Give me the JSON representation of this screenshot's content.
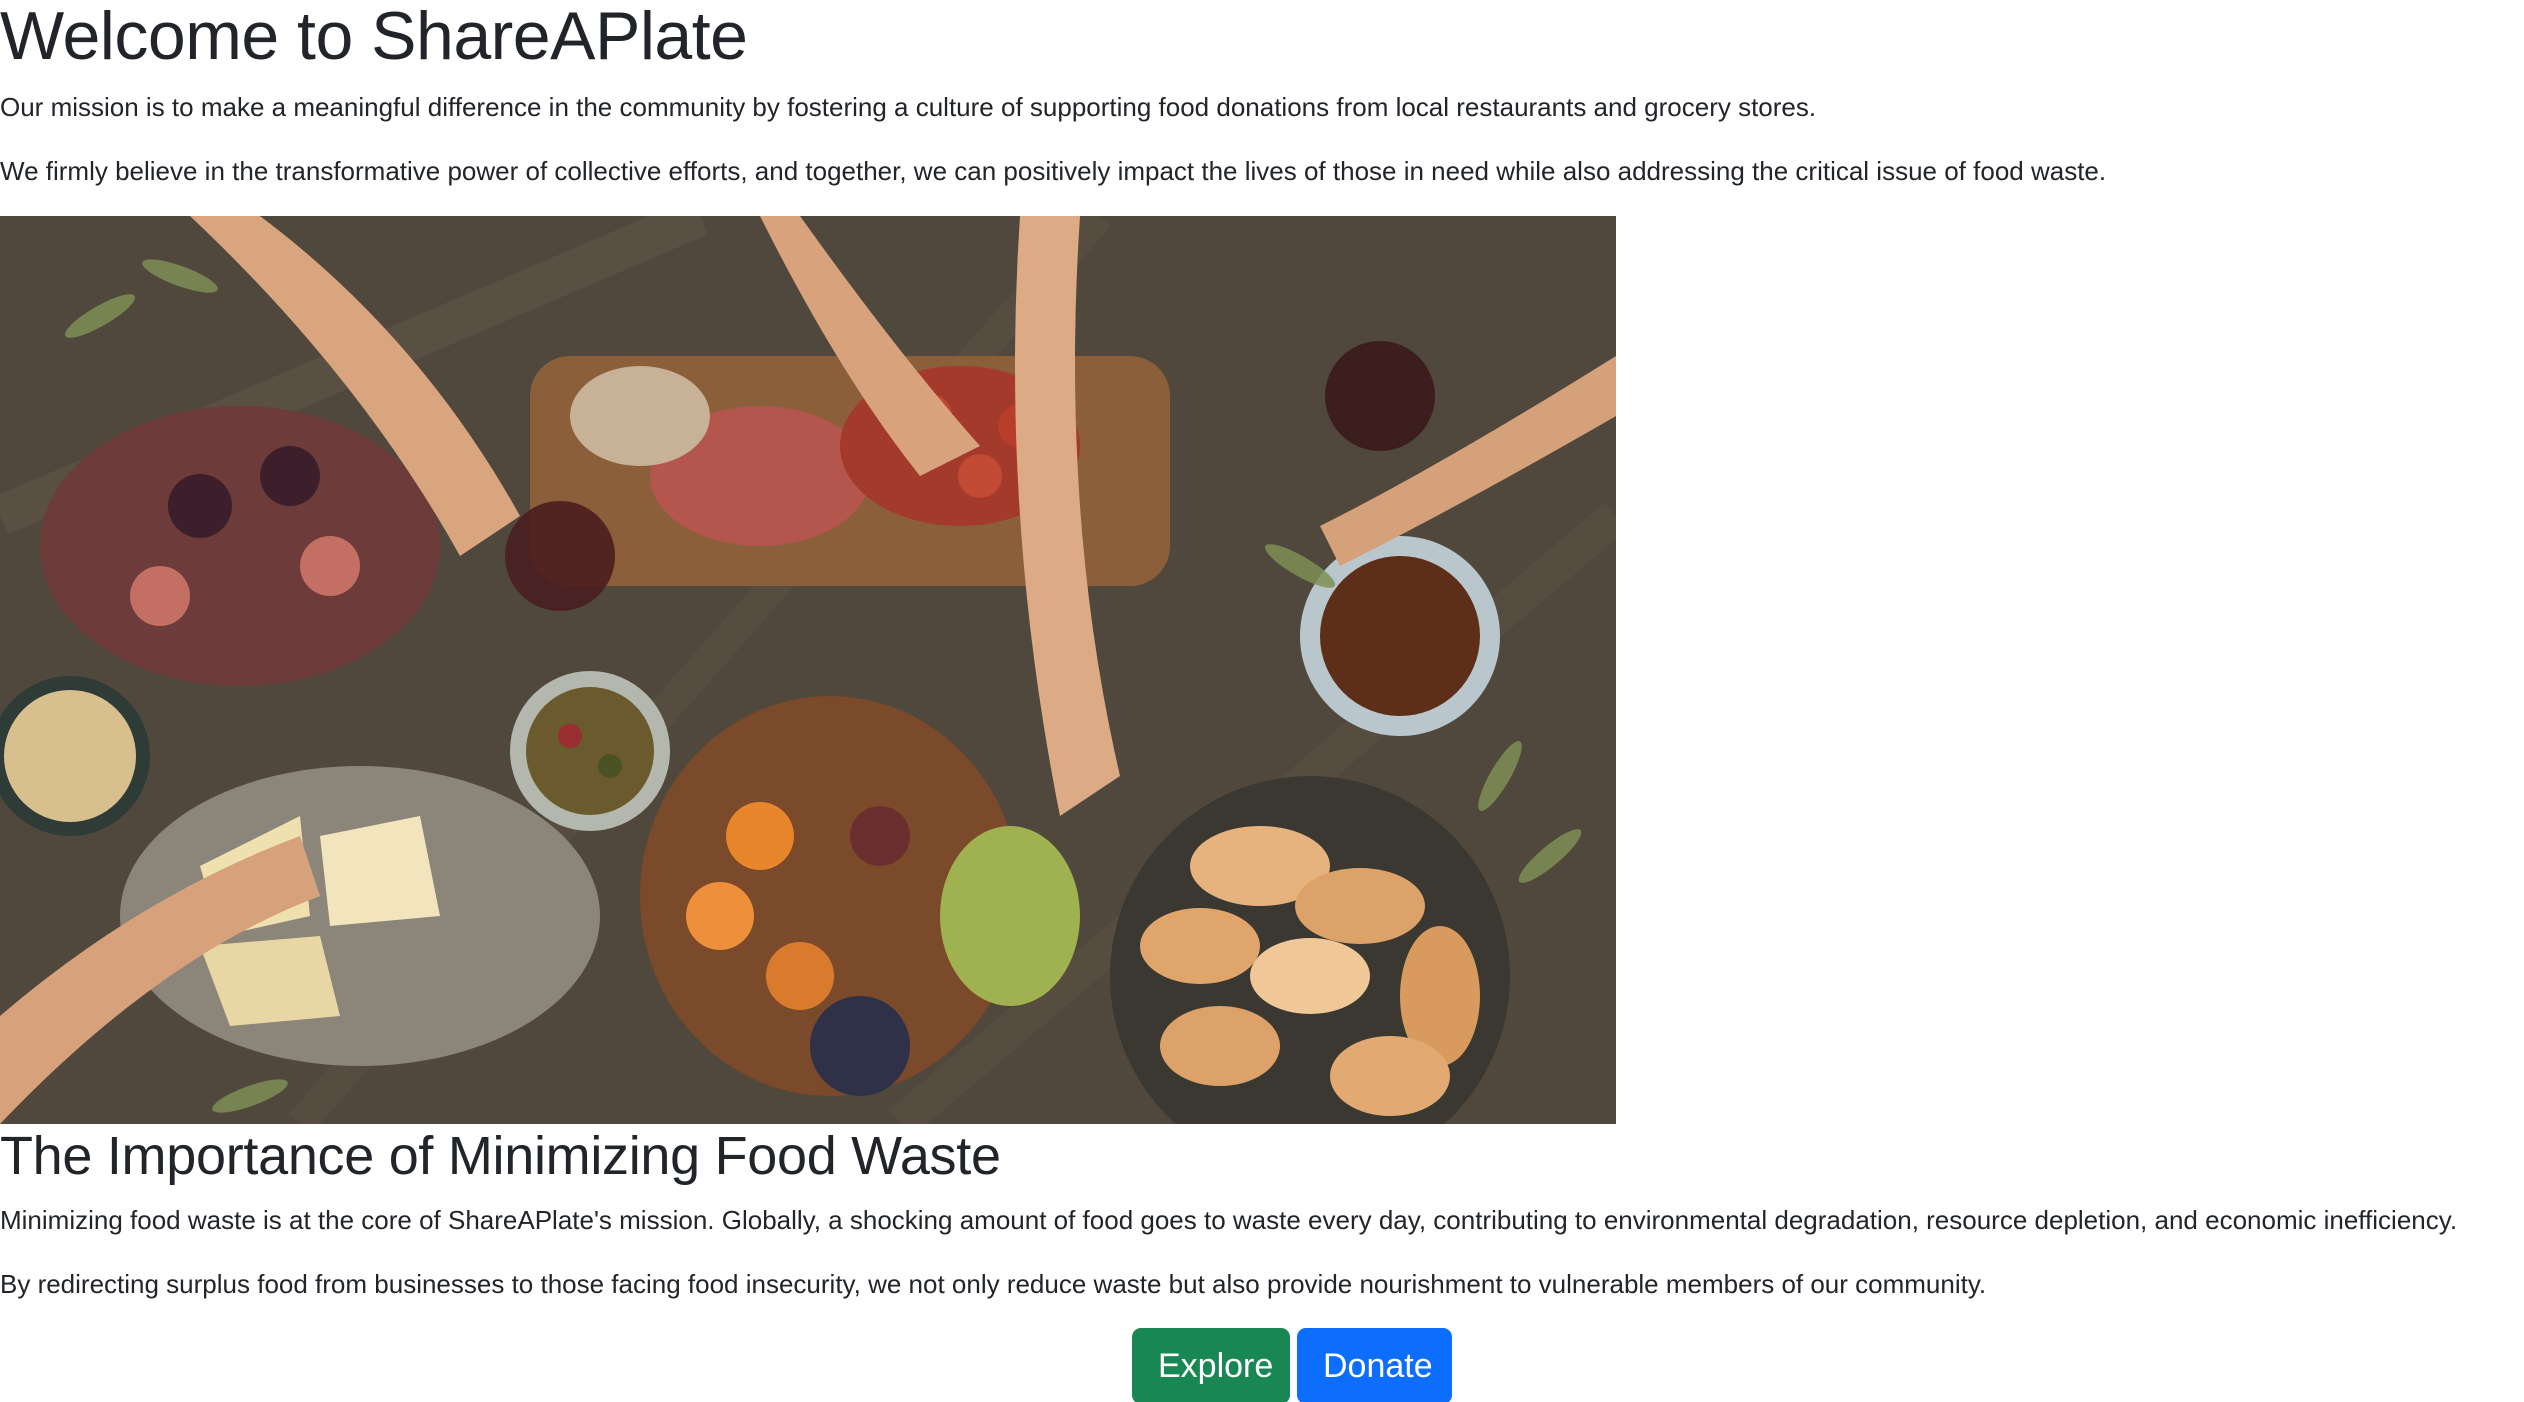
{
  "header": {
    "title": "Welcome to ShareAPlate"
  },
  "intro": {
    "mission": "Our mission is to make a meaningful difference in the community by fostering a culture of supporting food donations from local restaurants and grocery stores.",
    "belief": "We firmly believe in the transformative power of collective efforts, and together, we can positively impact the lives of those in need while also addressing the critical issue of food waste."
  },
  "section": {
    "title": "The Importance of Minimizing Food Waste",
    "para1": "Minimizing food waste is at the core of ShareAPlate's mission. Globally, a shocking amount of food goes to waste every day, contributing to environmental degradation, resource depletion, and economic inefficiency.",
    "para2": "By redirecting surplus food from businesses to those facing food insecurity, we not only reduce waste but also provide nourishment to vulnerable members of our community."
  },
  "actions": {
    "explore_label": "Explore",
    "donate_label": "Donate"
  },
  "colors": {
    "explore": "#198754",
    "donate": "#0d6efd",
    "text": "#212529"
  }
}
